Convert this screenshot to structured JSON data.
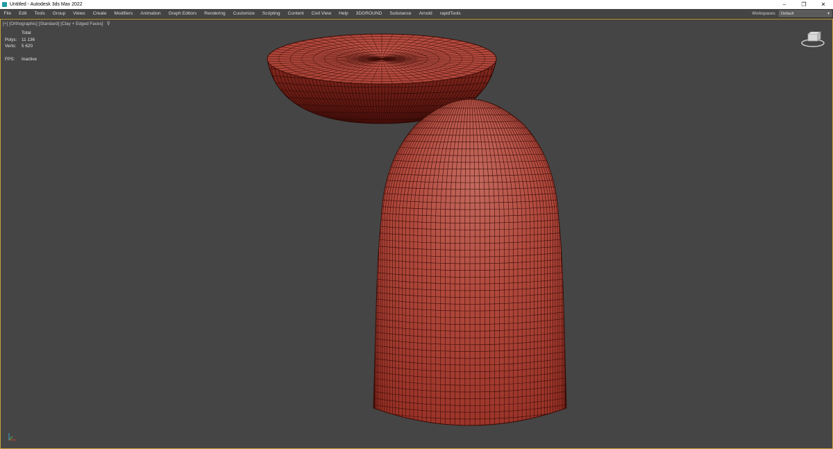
{
  "titlebar": {
    "title": "Untitled - Autodesk 3ds Max 2022",
    "minimize": "–",
    "restore": "❐",
    "close": "✕"
  },
  "menubar": {
    "items": [
      "File",
      "Edit",
      "Tools",
      "Group",
      "Views",
      "Create",
      "Modifiers",
      "Animation",
      "Graph Editors",
      "Rendering",
      "Customize",
      "Scripting",
      "Content",
      "Civil View",
      "Help",
      "3DGROUND",
      "Substance",
      "Arnold",
      "rapidTools"
    ],
    "workspaces_label": "Workspaces:",
    "workspaces_value": "Default"
  },
  "viewport": {
    "label_parts": [
      "[+]",
      "[Orthographic]",
      "[Standard]",
      "[Clay + Edged Faces]"
    ],
    "stats": {
      "header": "Total",
      "polys_label": "Polys:",
      "polys_value": "11 136",
      "verts_label": "Verts:",
      "verts_value": "5 620",
      "fps_label": "FPS:",
      "fps_value": "Inactive"
    },
    "object_color": "#b44a3e",
    "wire_color": "#3a0d08",
    "border_color": "#c8a23a"
  },
  "icons": {
    "filter": "filter-icon",
    "viewcube": "viewcube-icon",
    "axis": "axis-tripod-icon"
  }
}
